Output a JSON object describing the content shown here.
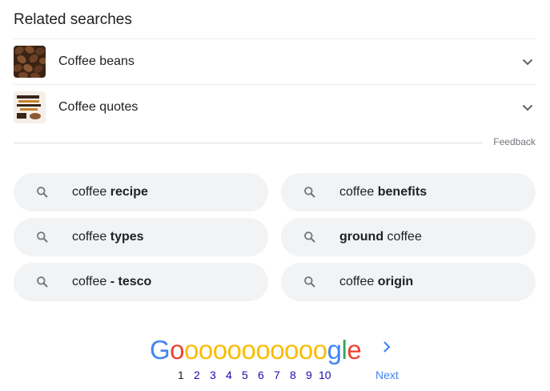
{
  "related": {
    "heading": "Related searches",
    "items": [
      {
        "label": "Coffee beans",
        "icon": "chevron-down-icon"
      },
      {
        "label": "Coffee quotes",
        "icon": "chevron-down-icon"
      }
    ],
    "feedback": "Feedback"
  },
  "chips": [
    {
      "prefix": "coffee ",
      "bold": "recipe",
      "suffix": ""
    },
    {
      "prefix": "coffee ",
      "bold": "benefits",
      "suffix": ""
    },
    {
      "prefix": "coffee ",
      "bold": "types",
      "suffix": ""
    },
    {
      "prefix": "",
      "bold": "ground",
      "suffix": " coffee"
    },
    {
      "prefix": "coffee ",
      "bold": "- tesco",
      "suffix": ""
    },
    {
      "prefix": "coffee ",
      "bold": "origin",
      "suffix": ""
    }
  ],
  "pagination": {
    "logo_letters": [
      "G",
      "o",
      "o",
      "o",
      "o",
      "o",
      "o",
      "o",
      "o",
      "o",
      "o",
      "o",
      "g",
      "l",
      "e"
    ],
    "logo_colors": {
      "blue": "#4285f4",
      "red": "#ea4335",
      "yellow": "#fbbc05",
      "green": "#34a853"
    },
    "pages": [
      "1",
      "2",
      "3",
      "4",
      "5",
      "6",
      "7",
      "8",
      "9",
      "10"
    ],
    "current": "1",
    "next": "Next"
  }
}
